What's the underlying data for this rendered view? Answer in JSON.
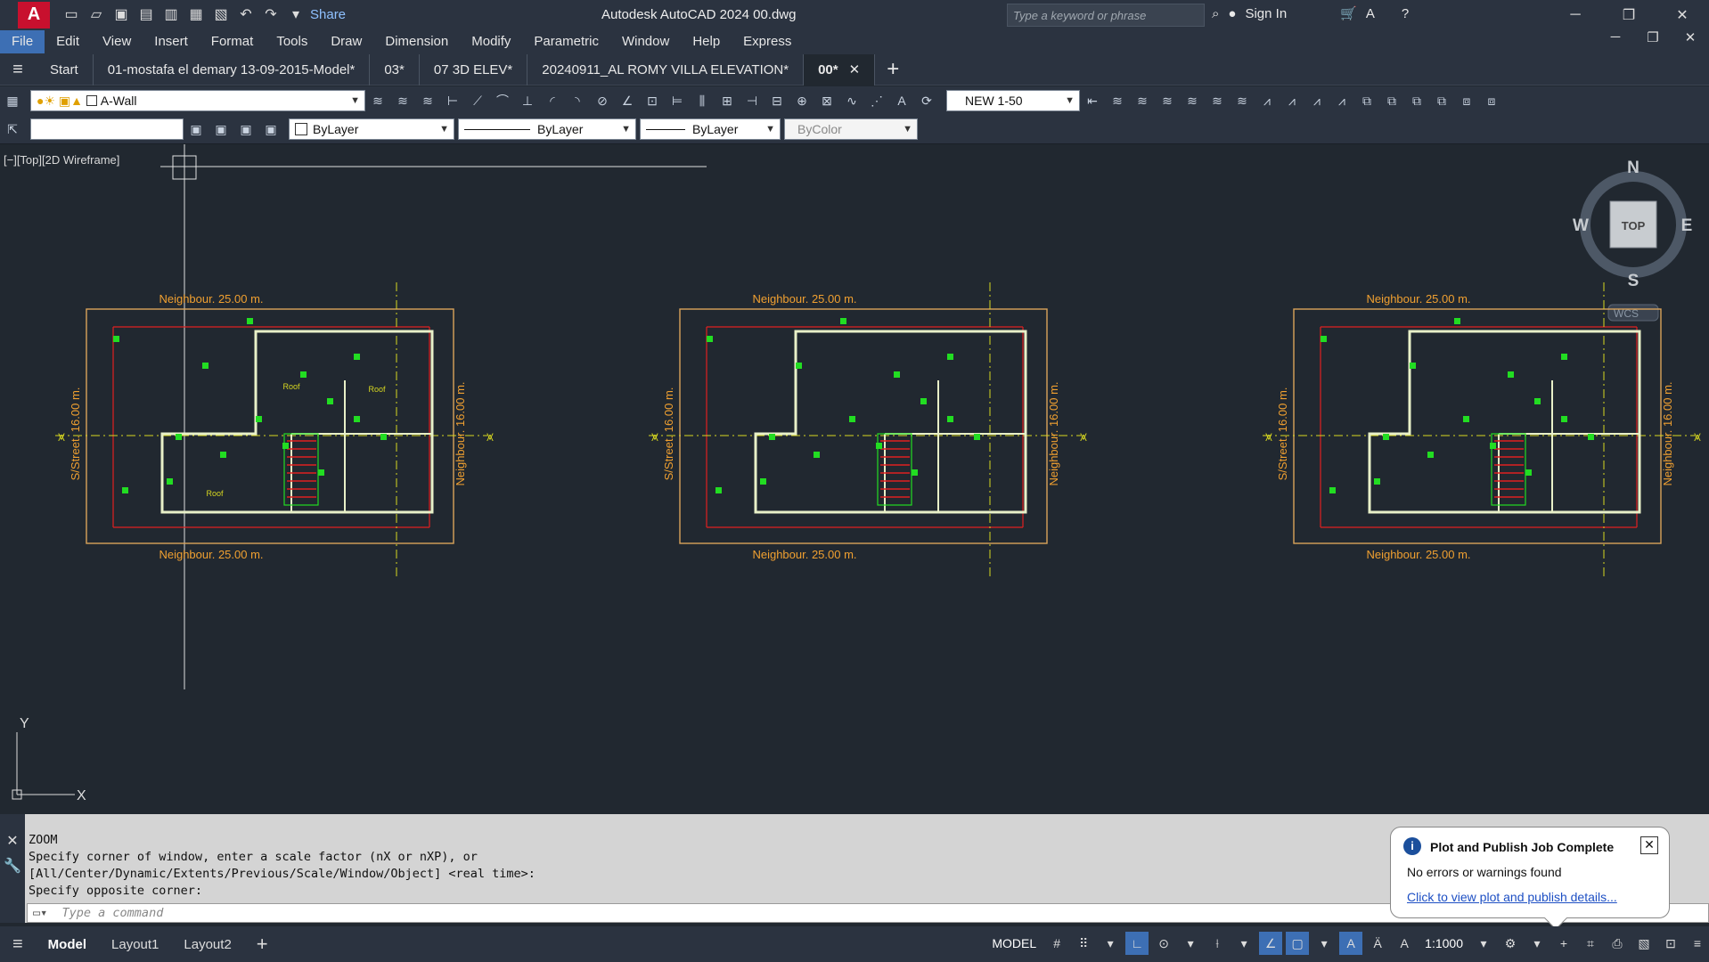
{
  "app": {
    "title": "Autodesk AutoCAD 2024    00.dwg",
    "share": "Share",
    "search_placeholder": "Type a keyword or phrase",
    "sign_in": "Sign In"
  },
  "menu": [
    "File",
    "Edit",
    "View",
    "Insert",
    "Format",
    "Tools",
    "Draw",
    "Dimension",
    "Modify",
    "Parametric",
    "Window",
    "Help",
    "Express"
  ],
  "tabs": [
    {
      "label": "Start",
      "active": false
    },
    {
      "label": "01-mostafa el demary 13-09-2015-Model*",
      "active": false
    },
    {
      "label": "03*",
      "active": false
    },
    {
      "label": "07 3D ELEV*",
      "active": false
    },
    {
      "label": "20240911_AL ROMY VILLA ELEVATION*",
      "active": false
    },
    {
      "label": "00*",
      "active": true
    }
  ],
  "toolbar": {
    "layer": "A-Wall",
    "dimstyle": "NEW 1-50",
    "color": "ByLayer",
    "linetype": "ByLayer",
    "lineweight": "ByLayer",
    "plotstyle": "ByColor"
  },
  "viewport": {
    "label": "[−][Top][2D Wireframe]"
  },
  "viewcube": {
    "n": "N",
    "s": "S",
    "e": "E",
    "w": "W",
    "face": "TOP",
    "wcs": "WCS"
  },
  "plans": [
    {
      "top": "Neighbour. 25.00 m.",
      "bottom": "Neighbour. 25.00 m.",
      "left": "S/Street. 16.00 m.",
      "right": "Neighbour. 16.00 m.",
      "rooms": [
        "Roof",
        "Roof",
        "Roof"
      ]
    },
    {
      "top": "Neighbour. 25.00 m.",
      "bottom": "Neighbour. 25.00 m.",
      "left": "S/Street. 16.00 m.",
      "right": "Neighbour. 16.00 m.",
      "rooms": []
    },
    {
      "top": "Neighbour. 25.00 m.",
      "bottom": "Neighbour. 25.00 m.",
      "left": "S/Street. 16.00 m.",
      "right": "Neighbour. 16.00 m.",
      "rooms": []
    }
  ],
  "ucs": {
    "x": "X",
    "y": "Y"
  },
  "command": {
    "history": [
      "ZOOM",
      "Specify corner of window, enter a scale factor (nX or nXP), or",
      "[All/Center/Dynamic/Extents/Previous/Scale/Window/Object] <real time>:",
      "Specify opposite corner:"
    ],
    "placeholder": "Type a command"
  },
  "status": {
    "tabs": [
      "Model",
      "Layout1",
      "Layout2"
    ],
    "model_label": "MODEL",
    "scale": "1:1000"
  },
  "notification": {
    "title": "Plot and Publish Job Complete",
    "message": "No errors or warnings found",
    "link": "Click to view plot and publish details..."
  },
  "colors": {
    "wall": "#e8f0c8",
    "boundary": "#d9a35a",
    "redline": "#e02020",
    "green": "#22dd22",
    "axis": "#d8d820",
    "dim_text": "#f0a030"
  }
}
